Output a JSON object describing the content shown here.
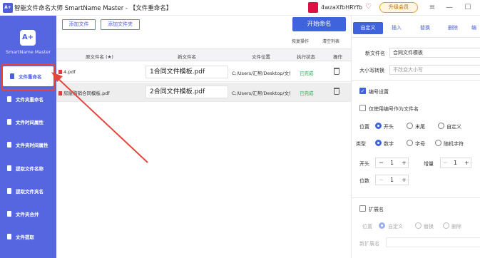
{
  "window": {
    "logo_text": "A+",
    "title": "智能文件命名大师 SmartName Master - 【文件重命名】",
    "user_name": "4wzaXfbHRYfb",
    "upgrade_label": "升级会员",
    "minimize": "—",
    "maximize": "☐",
    "close": "✕",
    "menu": "≡"
  },
  "sidebar": {
    "logo_text": "A+",
    "brand": "SmartName Master",
    "items": [
      {
        "label": "文件重命名"
      },
      {
        "label": "文件夹重命名"
      },
      {
        "label": "文件时间属性"
      },
      {
        "label": "文件夹时间属性"
      },
      {
        "label": "提取文件名称"
      },
      {
        "label": "提取文件夹名"
      },
      {
        "label": "文件夹合并"
      },
      {
        "label": "文件提取"
      }
    ]
  },
  "toolbar": {
    "add_file": "添加文件",
    "add_folder": "添加文件夹",
    "start": "开始命名",
    "restore": "恢复操作",
    "clear": "清空列表"
  },
  "table": {
    "headers": [
      "原文件名 (★)",
      "新文件名",
      "文件位置",
      "执行状态",
      "操作"
    ],
    "rows": [
      {
        "original": "4.pdf",
        "new_name": "1合同文件模板.pdf",
        "location": "C:/Users/汇帮/Desktop/文件",
        "status": "已完成"
      },
      {
        "original": "房屋购销合同模板.pdf",
        "new_name": "2合同文件模板.pdf",
        "location": "C:/Users/汇帮/Desktop/文件",
        "status": "已完成"
      }
    ]
  },
  "panel": {
    "tabs": [
      "自定义",
      "插入",
      "替换",
      "删除",
      "编"
    ],
    "new_name_label": "新文件名",
    "new_name_value": "合同文件模板",
    "case_label": "大小写转换",
    "case_placeholder": "不改变大小写",
    "numbering_label": "编号设置",
    "only_number_label": "仅使用编号作为文件名",
    "position_label": "位置",
    "position_options": [
      "开头",
      "末尾",
      "自定义"
    ],
    "type_label": "类型",
    "type_options": [
      "数字",
      "字母",
      "随机字符"
    ],
    "start_label": "开头",
    "start_value": "1",
    "increment_label": "增量",
    "increment_value": "1",
    "digits_label": "位数",
    "digits_value": "1",
    "minus": "−",
    "plus": "+",
    "extension_label": "扩展名",
    "ext_position_label": "位置",
    "ext_options": [
      "自定义",
      "替换",
      "删除"
    ],
    "new_ext_label": "新扩展名"
  },
  "colors": {
    "sidebar": "#5666e0",
    "accent": "#3e63dd",
    "annotation": "#e4463c",
    "status_done": "#2ba64b"
  }
}
